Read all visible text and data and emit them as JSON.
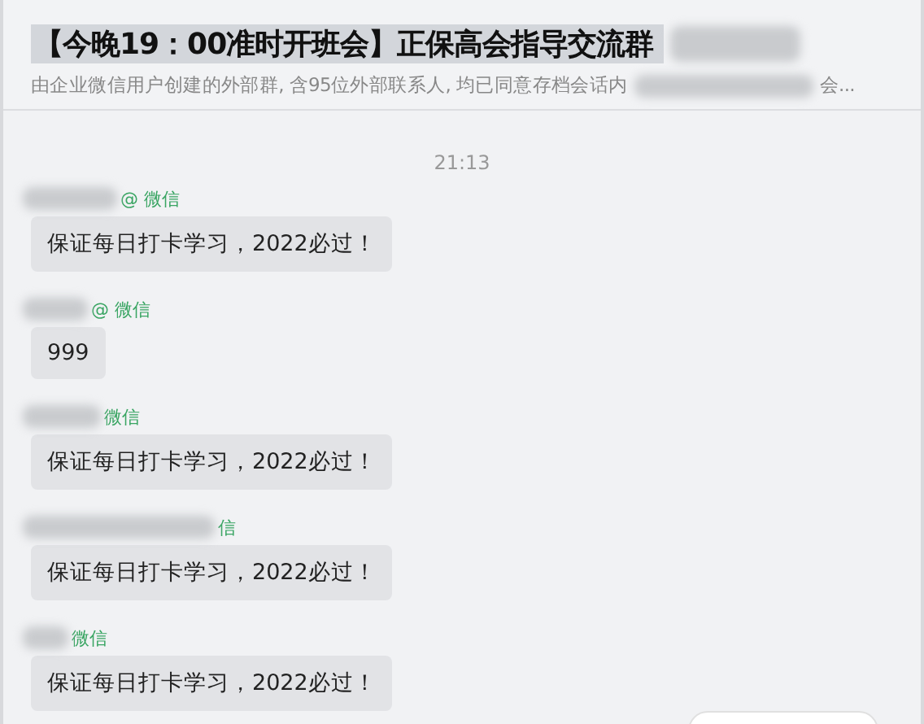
{
  "header": {
    "title": "【今晚19：00准时开班会】正保高会指导交流群",
    "subtitle": "由企业微信用户创建的外部群, 含95位外部联系人, 均已同意存档会话内",
    "subtitle_end": "会..."
  },
  "time": "21:13",
  "messages": [
    {
      "sender_suffix": "@ 微信",
      "text": "保证每日打卡学习，2022必过！"
    },
    {
      "sender_suffix": "@ 微信",
      "text": "999"
    },
    {
      "sender_suffix": "微信",
      "text": "保证每日打卡学习，2022必过！"
    },
    {
      "sender_suffix": "信",
      "text": "保证每日打卡学习，2022必过！"
    },
    {
      "sender_suffix": "微信",
      "text": "保证每日打卡学习，2022必过！"
    }
  ]
}
